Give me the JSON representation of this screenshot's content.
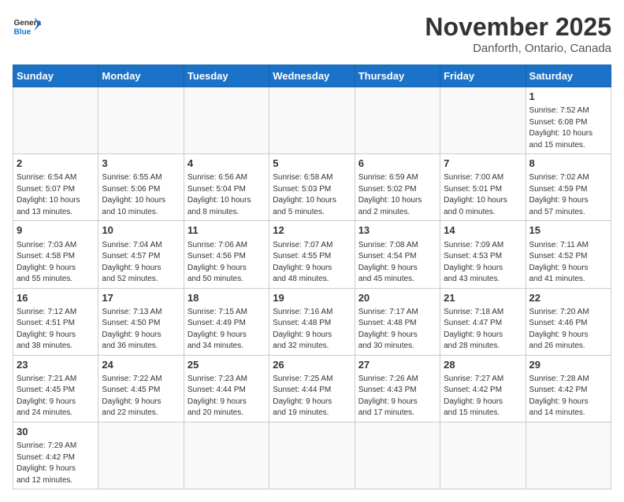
{
  "logo": {
    "general": "General",
    "blue": "Blue"
  },
  "title": "November 2025",
  "location": "Danforth, Ontario, Canada",
  "weekdays": [
    "Sunday",
    "Monday",
    "Tuesday",
    "Wednesday",
    "Thursday",
    "Friday",
    "Saturday"
  ],
  "days": {
    "1": "Sunrise: 7:52 AM\nSunset: 6:08 PM\nDaylight: 10 hours\nand 15 minutes.",
    "2": "Sunrise: 6:54 AM\nSunset: 5:07 PM\nDaylight: 10 hours\nand 13 minutes.",
    "3": "Sunrise: 6:55 AM\nSunset: 5:06 PM\nDaylight: 10 hours\nand 10 minutes.",
    "4": "Sunrise: 6:56 AM\nSunset: 5:04 PM\nDaylight: 10 hours\nand 8 minutes.",
    "5": "Sunrise: 6:58 AM\nSunset: 5:03 PM\nDaylight: 10 hours\nand 5 minutes.",
    "6": "Sunrise: 6:59 AM\nSunset: 5:02 PM\nDaylight: 10 hours\nand 2 minutes.",
    "7": "Sunrise: 7:00 AM\nSunset: 5:01 PM\nDaylight: 10 hours\nand 0 minutes.",
    "8": "Sunrise: 7:02 AM\nSunset: 4:59 PM\nDaylight: 9 hours\nand 57 minutes.",
    "9": "Sunrise: 7:03 AM\nSunset: 4:58 PM\nDaylight: 9 hours\nand 55 minutes.",
    "10": "Sunrise: 7:04 AM\nSunset: 4:57 PM\nDaylight: 9 hours\nand 52 minutes.",
    "11": "Sunrise: 7:06 AM\nSunset: 4:56 PM\nDaylight: 9 hours\nand 50 minutes.",
    "12": "Sunrise: 7:07 AM\nSunset: 4:55 PM\nDaylight: 9 hours\nand 48 minutes.",
    "13": "Sunrise: 7:08 AM\nSunset: 4:54 PM\nDaylight: 9 hours\nand 45 minutes.",
    "14": "Sunrise: 7:09 AM\nSunset: 4:53 PM\nDaylight: 9 hours\nand 43 minutes.",
    "15": "Sunrise: 7:11 AM\nSunset: 4:52 PM\nDaylight: 9 hours\nand 41 minutes.",
    "16": "Sunrise: 7:12 AM\nSunset: 4:51 PM\nDaylight: 9 hours\nand 38 minutes.",
    "17": "Sunrise: 7:13 AM\nSunset: 4:50 PM\nDaylight: 9 hours\nand 36 minutes.",
    "18": "Sunrise: 7:15 AM\nSunset: 4:49 PM\nDaylight: 9 hours\nand 34 minutes.",
    "19": "Sunrise: 7:16 AM\nSunset: 4:48 PM\nDaylight: 9 hours\nand 32 minutes.",
    "20": "Sunrise: 7:17 AM\nSunset: 4:48 PM\nDaylight: 9 hours\nand 30 minutes.",
    "21": "Sunrise: 7:18 AM\nSunset: 4:47 PM\nDaylight: 9 hours\nand 28 minutes.",
    "22": "Sunrise: 7:20 AM\nSunset: 4:46 PM\nDaylight: 9 hours\nand 26 minutes.",
    "23": "Sunrise: 7:21 AM\nSunset: 4:45 PM\nDaylight: 9 hours\nand 24 minutes.",
    "24": "Sunrise: 7:22 AM\nSunset: 4:45 PM\nDaylight: 9 hours\nand 22 minutes.",
    "25": "Sunrise: 7:23 AM\nSunset: 4:44 PM\nDaylight: 9 hours\nand 20 minutes.",
    "26": "Sunrise: 7:25 AM\nSunset: 4:44 PM\nDaylight: 9 hours\nand 19 minutes.",
    "27": "Sunrise: 7:26 AM\nSunset: 4:43 PM\nDaylight: 9 hours\nand 17 minutes.",
    "28": "Sunrise: 7:27 AM\nSunset: 4:42 PM\nDaylight: 9 hours\nand 15 minutes.",
    "29": "Sunrise: 7:28 AM\nSunset: 4:42 PM\nDaylight: 9 hours\nand 14 minutes.",
    "30": "Sunrise: 7:29 AM\nSunset: 4:42 PM\nDaylight: 9 hours\nand 12 minutes."
  }
}
